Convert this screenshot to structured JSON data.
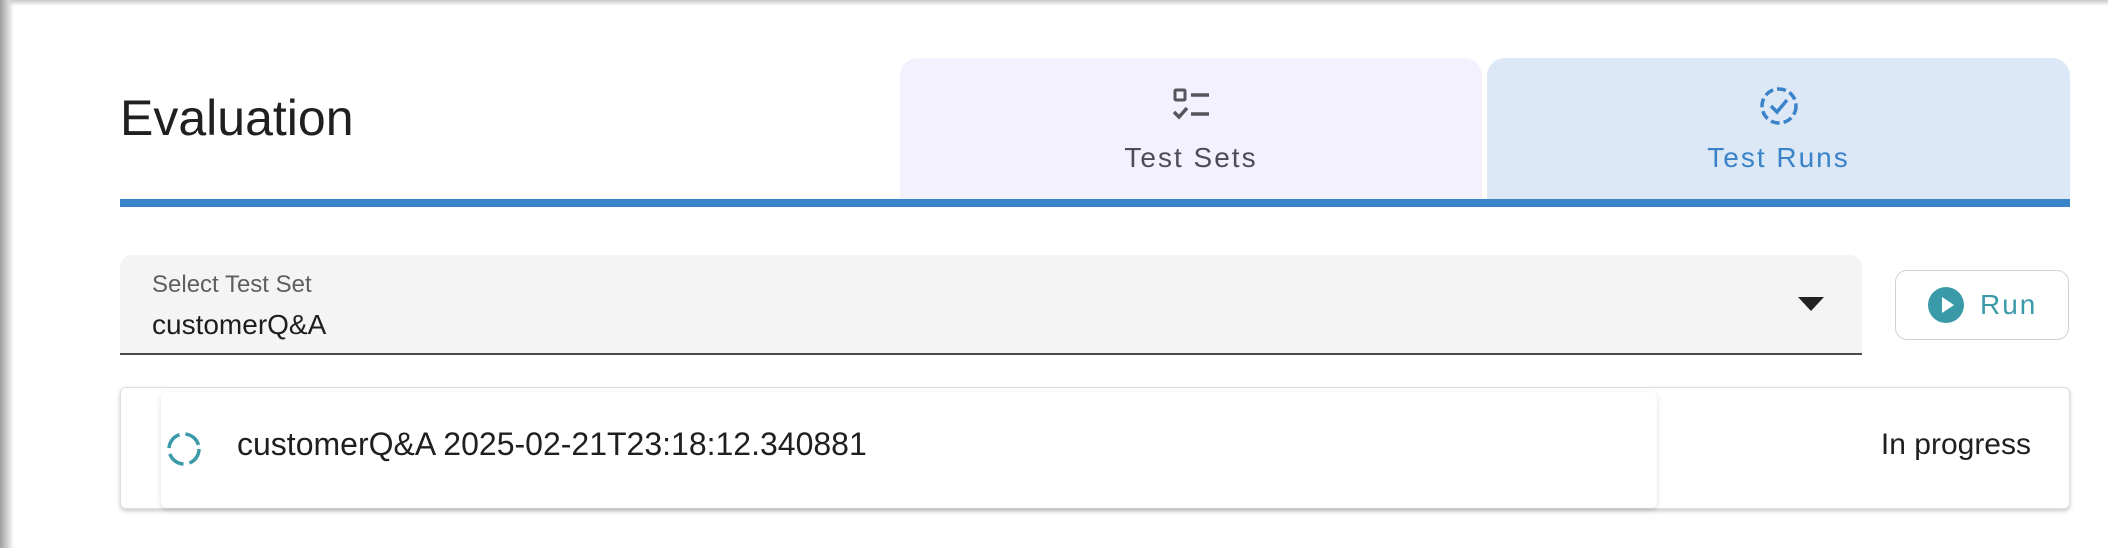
{
  "header": {
    "title": "Evaluation"
  },
  "tabs": [
    {
      "label": "Test Sets",
      "icon": "checklist-icon",
      "selected": false
    },
    {
      "label": "Test Runs",
      "icon": "dashed-check-circle-icon",
      "selected": true
    }
  ],
  "test_set_select": {
    "label": "Select Test Set",
    "value": "customerQ&A"
  },
  "run_button": {
    "label": "Run",
    "icon": "play-circle-icon"
  },
  "runs": [
    {
      "name": "customerQ&A 2025-02-21T23:18:12.340881",
      "status": "In progress",
      "icon": "spinner-icon"
    }
  ],
  "colors": {
    "accent": "#3b83c8",
    "run_teal": "#3a9aa8",
    "tab_sets_bg": "#f3f1fd",
    "tab_runs_bg": "#dce8f5"
  }
}
